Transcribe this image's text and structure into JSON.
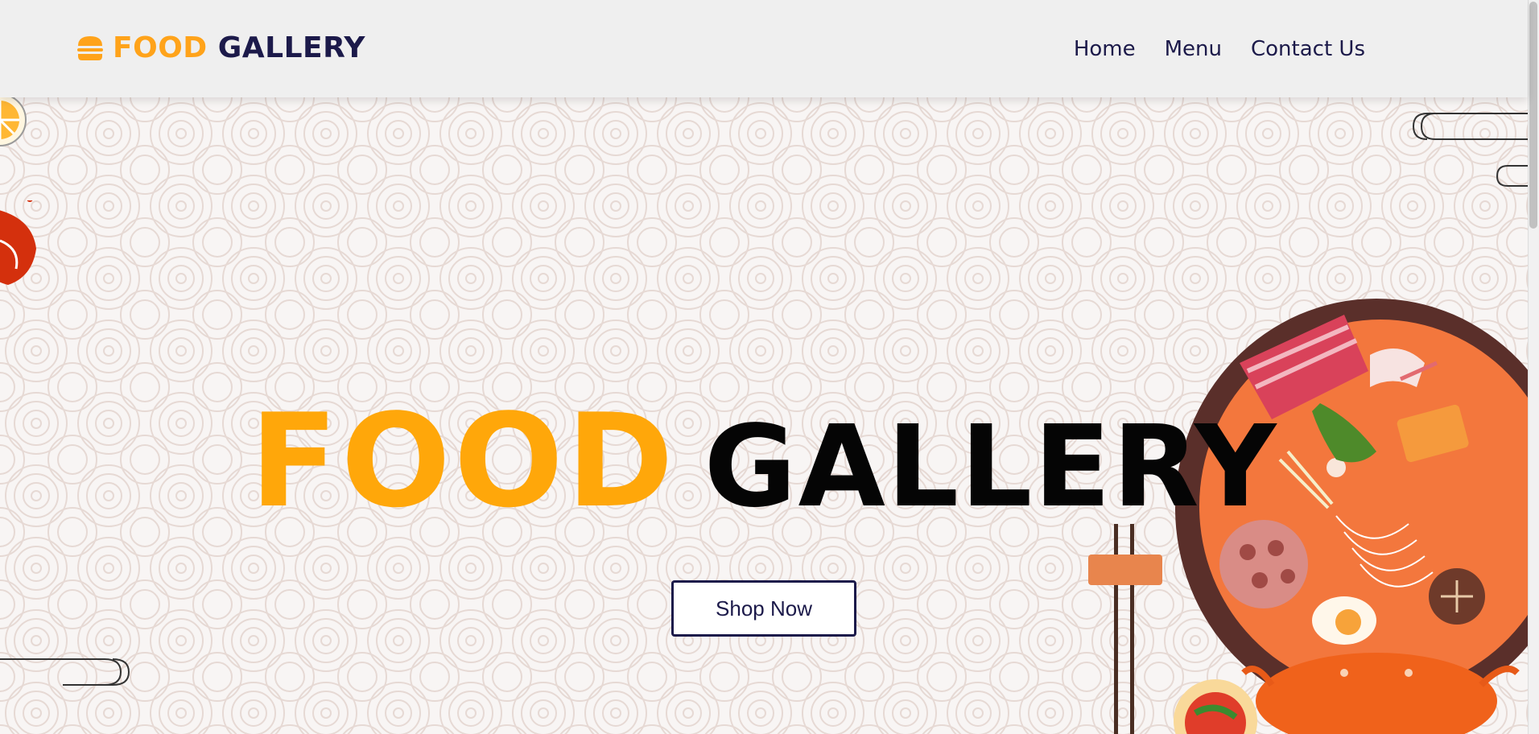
{
  "brand": {
    "icon": "burger-icon",
    "word1": "FOOD",
    "word2": "GALLERY"
  },
  "nav": {
    "items": [
      {
        "label": "Home"
      },
      {
        "label": "Menu"
      },
      {
        "label": "Contact Us"
      }
    ]
  },
  "hero": {
    "title_word1": "FOOD",
    "title_word2": "GALLERY",
    "cta_label": "Shop Now",
    "decorations": [
      "lemon-slice-illustration",
      "lobster-claw-illustration",
      "hotpot-illustration",
      "chopsticks-illustration",
      "cloud-line-decoration"
    ]
  },
  "colors": {
    "accent": "#ffa70a",
    "navy": "#1c1a4a",
    "navbar_bg": "#efefef",
    "hero_bg": "#f8f5f4"
  }
}
